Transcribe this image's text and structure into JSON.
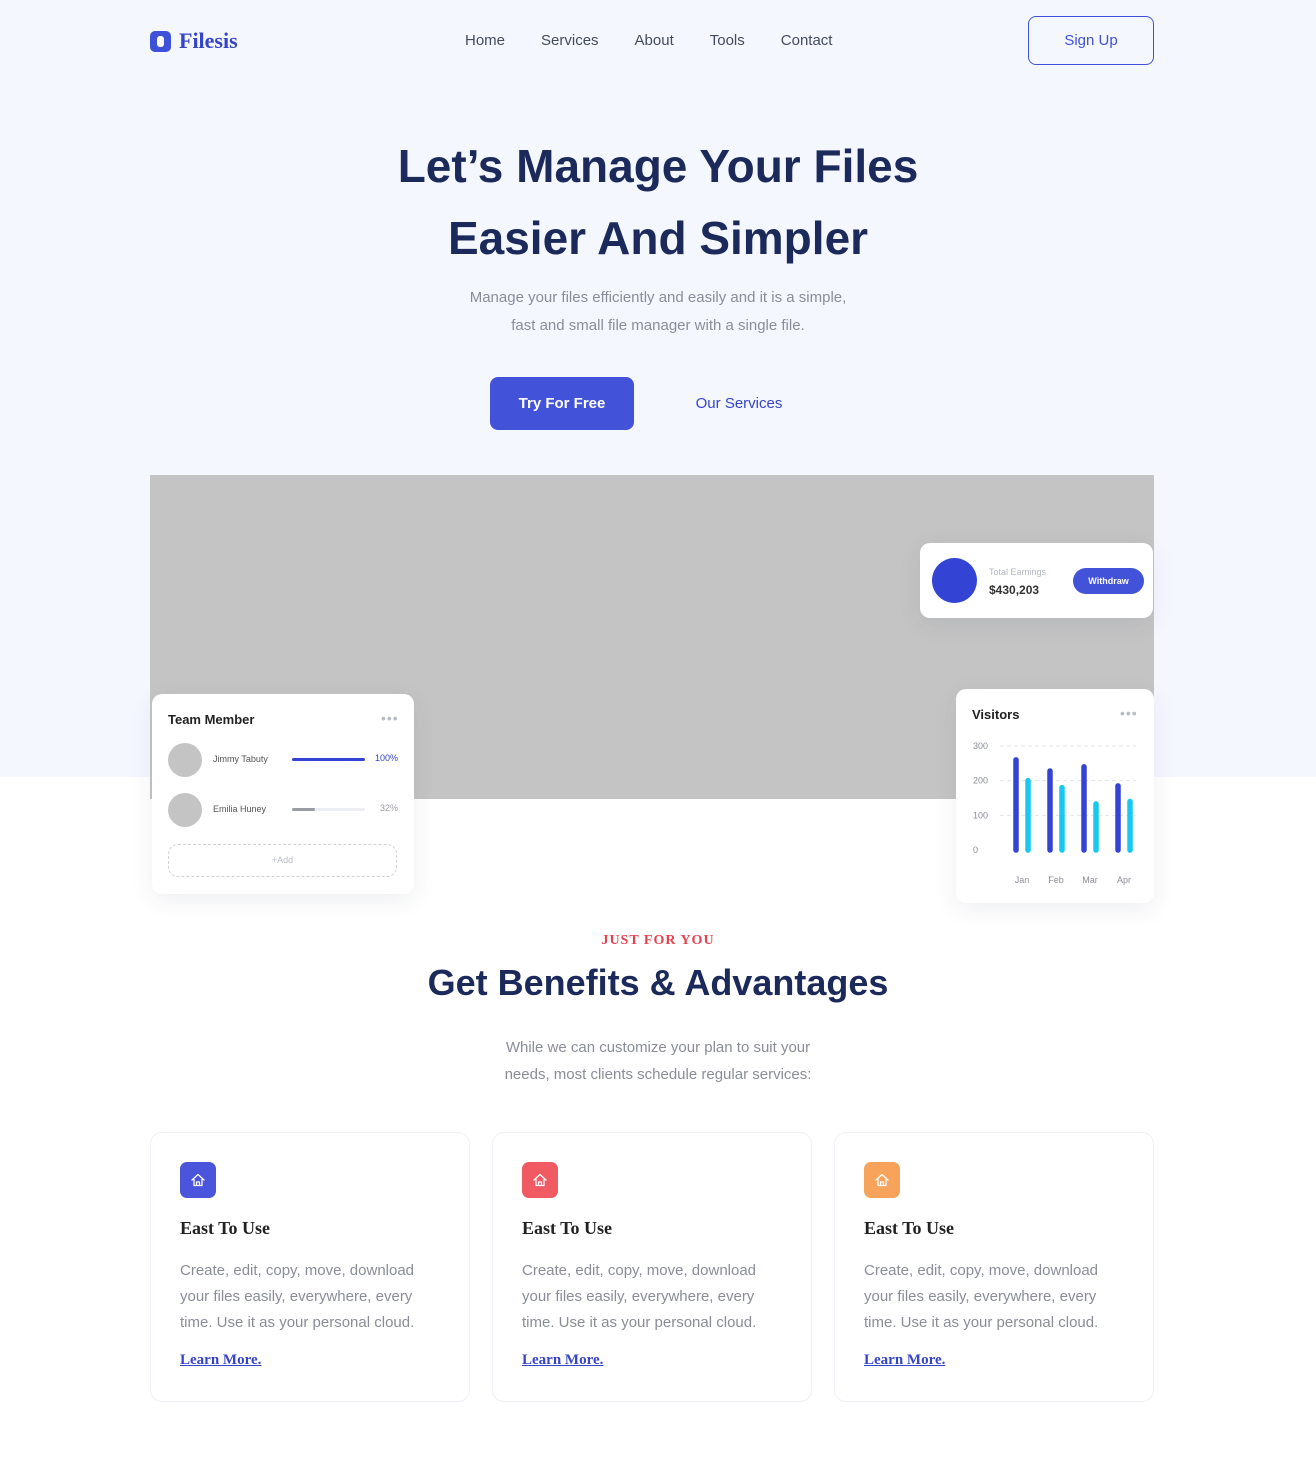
{
  "brand": {
    "name": "Filesis",
    "accent": "#3f51d8"
  },
  "nav": {
    "items": [
      "Home",
      "Services",
      "About",
      "Tools",
      "Contact"
    ],
    "signup_label": "Sign Up"
  },
  "hero": {
    "title_line1": "Let’s Manage Your Files",
    "title_line2": "Easier And Simpler",
    "subtitle_line1": "Manage your files efficiently and easily and it is a simple,",
    "subtitle_line2": "fast and small file manager with a single file.",
    "primary_cta": "Try For Free",
    "secondary_cta": "Our Services"
  },
  "earnings": {
    "label": "Total Earnings",
    "value": "$430,203",
    "button": "Withdraw"
  },
  "team": {
    "title": "Team Member",
    "members": [
      {
        "name": "Jimmy Tabuty",
        "progress": 100,
        "percent_label": "100%",
        "color": "#3343d4"
      },
      {
        "name": "Emilia Huney",
        "progress": 32,
        "percent_label": "32%",
        "color": "#9a9ca3"
      }
    ],
    "add_label": "+Add"
  },
  "visitors": {
    "title": "Visitors",
    "colors": {
      "series_a": "#3343d4",
      "series_b": "#16c8f2"
    }
  },
  "chart_data": {
    "type": "bar",
    "title": "Visitors",
    "categories": [
      "Jan",
      "Feb",
      "Mar",
      "Apr"
    ],
    "series": [
      {
        "values": [
          260,
          228,
          240,
          185
        ]
      },
      {
        "values": [
          200,
          180,
          133,
          140
        ]
      }
    ],
    "yticks": [
      "300",
      "200",
      "100",
      "0"
    ],
    "ylim": [
      0,
      300
    ],
    "grid": true
  },
  "benefits": {
    "eyebrow": "JUST FOR YOU",
    "title": "Get Benefits & Advantages",
    "subtitle_line1": "While we can customize your plan to suit your",
    "subtitle_line2": "needs, most clients schedule regular services:",
    "cards": [
      {
        "icon": "home-icon",
        "color": "#4a55dc",
        "title": "East To Use",
        "text": "Create, edit, copy, move, download your files easily, everywhere, every time. Use it as your personal cloud.",
        "link": "Learn More."
      },
      {
        "icon": "home-icon",
        "color": "#f05a63",
        "title": "East To Use",
        "text": "Create, edit, copy, move, download your files easily, everywhere, every time. Use it as your personal cloud.",
        "link": "Learn More."
      },
      {
        "icon": "home-icon",
        "color": "#f7a35c",
        "title": "East To Use",
        "text": "Create, edit, copy, move, download your files easily, everywhere, every time. Use it as your personal cloud.",
        "link": "Learn More."
      }
    ]
  }
}
